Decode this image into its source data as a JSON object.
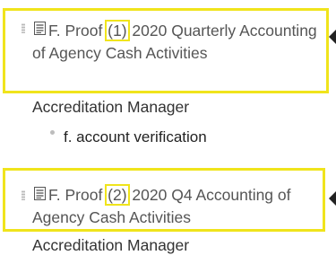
{
  "items": [
    {
      "title_prefix": "F. Proof ",
      "title_number": "(1)",
      "title_suffix": " 2020 Quarterly Accounting of Agency Cash Activities",
      "owner": "Accreditation Manager",
      "subitems": [
        {
          "label": "f. account verification"
        }
      ]
    },
    {
      "title_prefix": "F. Proof ",
      "title_number": "(2)",
      "title_suffix": " 2020 Q4 Accounting of",
      "title_suffix_line2": "Agency Cash Activities",
      "owner": "Accreditation Manager"
    }
  ],
  "colors": {
    "highlight": "#f0e41c",
    "title_text": "#555555",
    "owner_text": "#333333"
  },
  "icons": [
    "drag-handle-icon",
    "document-icon",
    "collapse-arrow-icon",
    "bullet-icon"
  ]
}
